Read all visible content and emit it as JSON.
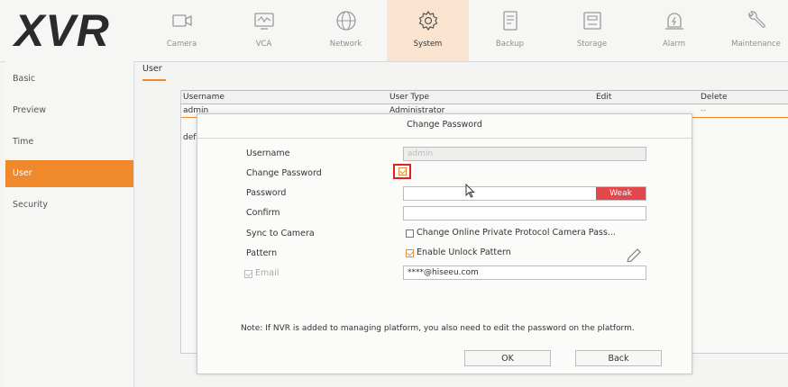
{
  "app": {
    "logo": "XVR"
  },
  "nav": {
    "items": [
      {
        "label": "Camera",
        "icon": "camera-icon"
      },
      {
        "label": "VCA",
        "icon": "vca-icon"
      },
      {
        "label": "Network",
        "icon": "network-globe-icon"
      },
      {
        "label": "System",
        "icon": "gear-icon",
        "active": true
      },
      {
        "label": "Backup",
        "icon": "backup-icon"
      },
      {
        "label": "Storage",
        "icon": "storage-icon"
      },
      {
        "label": "Alarm",
        "icon": "alarm-icon"
      },
      {
        "label": "Maintenance",
        "icon": "wrench-icon"
      }
    ]
  },
  "sidebar": {
    "items": [
      {
        "label": "Basic"
      },
      {
        "label": "Preview"
      },
      {
        "label": "Time"
      },
      {
        "label": "User",
        "active": true
      },
      {
        "label": "Security"
      }
    ]
  },
  "tab": {
    "label": "User"
  },
  "table": {
    "headers": [
      "Username",
      "User Type",
      "Edit",
      "Delete"
    ],
    "rows": [
      [
        "admin",
        "Administrator",
        "",
        "--"
      ],
      [
        "def",
        "",
        "",
        ""
      ]
    ]
  },
  "dialog": {
    "title": "Change Password",
    "username_label": "Username",
    "username_value": "admin",
    "change_password_label": "Change Password",
    "change_password_checked": true,
    "password_label": "Password",
    "password_strength": "Weak",
    "confirm_label": "Confirm",
    "sync_label": "Sync to Camera",
    "sync_option": "Change Online Private Protocol Camera Pass...",
    "sync_checked": false,
    "pattern_label": "Pattern",
    "pattern_option": "Enable Unlock Pattern",
    "pattern_checked": true,
    "email_label": "Email",
    "email_checked": true,
    "email_value": "****@hiseeu.com",
    "note": "Note: If NVR is added to managing platform, you also need to edit the password on the platform.",
    "ok_label": "OK",
    "back_label": "Back"
  },
  "colors": {
    "accent": "#f0892b",
    "weak": "#e2474c",
    "highlight": "#e02020"
  }
}
